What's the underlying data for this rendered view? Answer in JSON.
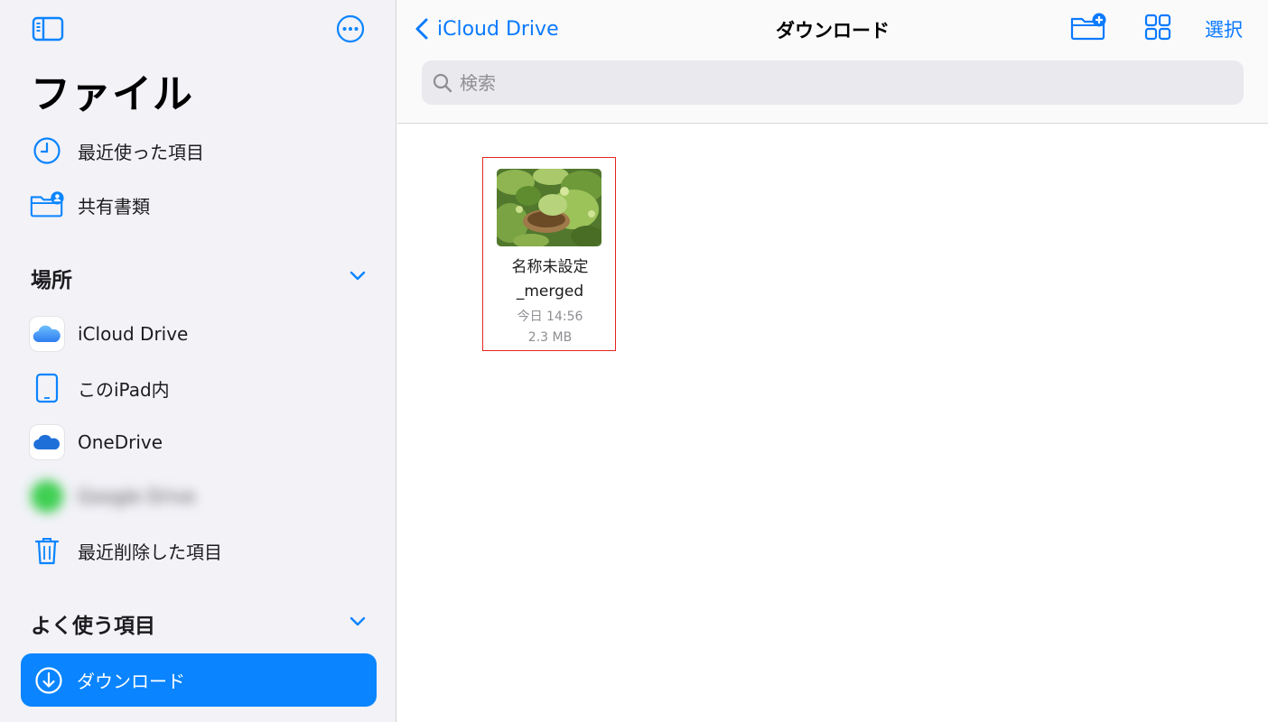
{
  "sidebar": {
    "title": "ファイル",
    "items": [
      {
        "label": "最近使った項目"
      },
      {
        "label": "共有書類"
      }
    ],
    "locations_header": "場所",
    "locations": [
      {
        "label": "iCloud Drive"
      },
      {
        "label": "このiPad内"
      },
      {
        "label": "OneDrive"
      },
      {
        "label": "Google Drive"
      },
      {
        "label": "最近削除した項目"
      }
    ],
    "favorites_header": "よく使う項目",
    "favorites": [
      {
        "label": "ダウンロード"
      }
    ]
  },
  "toolbar": {
    "back_label": "iCloud Drive",
    "title": "ダウンロード",
    "select_label": "選択"
  },
  "search": {
    "placeholder": "検索"
  },
  "files": [
    {
      "name_line1": "名称未設定",
      "name_line2": "_merged",
      "date": "今日 14:56",
      "size": "2.3 MB"
    }
  ],
  "colors": {
    "accent": "#0a84ff",
    "link": "#0a7aff",
    "highlight_border": "#e52620",
    "sidebar_bg": "#f2f2f7"
  }
}
